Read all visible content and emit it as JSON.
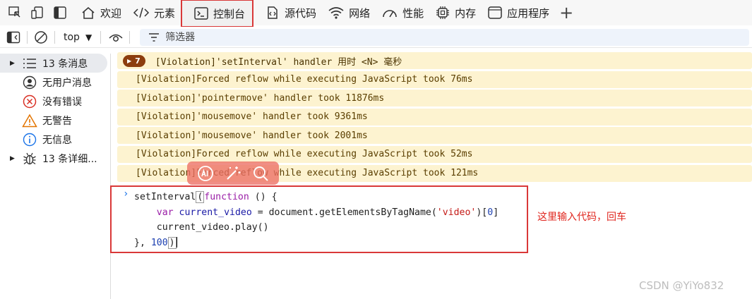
{
  "tabbar": {
    "tabs": [
      {
        "label": "欢迎",
        "icon": "home-icon"
      },
      {
        "label": "元素",
        "icon": "code-brackets-icon"
      },
      {
        "label": "控制台",
        "icon": "terminal-icon",
        "active": true
      },
      {
        "label": "源代码",
        "icon": "sources-icon"
      },
      {
        "label": "网络",
        "icon": "wifi-icon"
      },
      {
        "label": "性能",
        "icon": "gauge-icon"
      },
      {
        "label": "内存",
        "icon": "chip-icon"
      },
      {
        "label": "应用程序",
        "icon": "app-window-icon"
      }
    ],
    "add_tab_label": "+"
  },
  "toolbar": {
    "context": "top",
    "context_caret": "▼",
    "filter_placeholder": "筛选器"
  },
  "sidebar": {
    "items": [
      {
        "label": "13 条消息",
        "icon": "list-icon",
        "expandable": true,
        "selected": true
      },
      {
        "label": "无用户消息",
        "icon": "user-icon",
        "expandable": false
      },
      {
        "label": "没有错误",
        "icon": "error-icon",
        "expandable": false
      },
      {
        "label": "无警告",
        "icon": "warning-icon",
        "expandable": false
      },
      {
        "label": "无信息",
        "icon": "info-icon",
        "expandable": false
      },
      {
        "label": "13 条详细...",
        "icon": "bug-icon",
        "expandable": true
      }
    ]
  },
  "console": {
    "group": {
      "count": "7",
      "text": "[Violation]'setInterval' handler 用时 <N> 毫秒"
    },
    "messages": [
      "[Violation]Forced reflow while executing JavaScript took 76ms",
      "[Violation]'pointermove' handler took 11876ms",
      "[Violation]'mousemove' handler took 9361ms",
      "[Violation]'mousemove' handler took 2001ms",
      "[Violation]Forced reflow while executing JavaScript took 52ms",
      "[Violation]Forced reflow while executing JavaScript took 121ms"
    ],
    "prompt": "›",
    "code": {
      "l1a": "setInterval",
      "l1b": "(",
      "l1c": "function",
      "l1d": " () {",
      "l2a": "var",
      "l2b": "current_video",
      "l2c": " = document.getElementsByTagName(",
      "l2d": "'video'",
      "l2e": ")[",
      "l2f": "0",
      "l2g": "]",
      "l3": "current_video.play()",
      "l4a": "}, ",
      "l4b": "100",
      "l4c": ")"
    }
  },
  "annotation": "这里输入代码，回车",
  "watermark": "CSDN @YiYo832",
  "colors": {
    "accent_red": "#d93838",
    "violation_bg": "#fdf3d0",
    "badge_bg": "#8c3d0e",
    "link_blue": "#1a73e8"
  }
}
